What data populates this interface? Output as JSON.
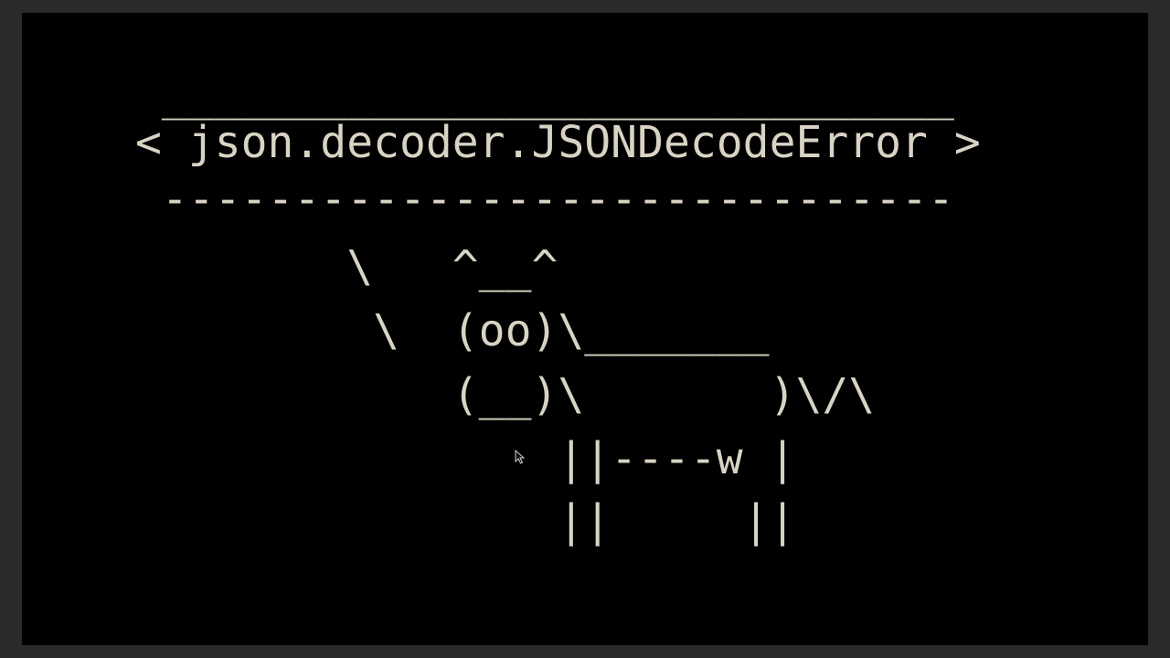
{
  "terminal": {
    "text_color": "#d8d3c4",
    "background_color": "#000000",
    "lines": [
      " ______________________________",
      "< json.decoder.JSONDecodeError >",
      " ------------------------------",
      "        \\   ^__^",
      "         \\  (oo)\\_______",
      "            (__)\\       )\\/\\",
      "                ||----w |",
      "                ||     ||"
    ]
  },
  "cursor": {
    "icon": "mouse-pointer-icon"
  }
}
